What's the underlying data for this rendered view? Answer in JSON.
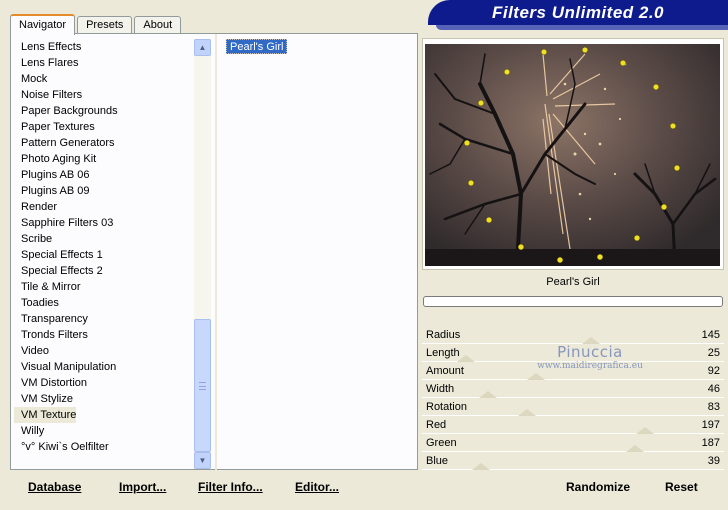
{
  "tabs": [
    {
      "label": "Navigator",
      "active": true
    },
    {
      "label": "Presets",
      "active": false
    },
    {
      "label": "About",
      "active": false
    }
  ],
  "banner": {
    "title": "Filters Unlimited 2.0"
  },
  "categories": {
    "items": [
      "Lens Effects",
      "Lens Flares",
      "Mock",
      "Noise Filters",
      "Paper Backgrounds",
      "Paper Textures",
      "Pattern Generators",
      "Photo Aging Kit",
      "Plugins AB 06",
      "Plugins AB 09",
      "Render",
      "Sapphire Filters 03",
      "Scribe",
      "Special Effects 1",
      "Special Effects 2",
      "Tile & Mirror",
      "Toadies",
      "Transparency",
      "Tronds Filters",
      "Video",
      "Visual Manipulation",
      "VM Distortion",
      "VM Stylize",
      "VM Texture",
      "Willy",
      "°v° Kiwi`s Oelfilter"
    ],
    "selected": "VM Texture"
  },
  "filters": {
    "items": [
      "Pearl's Girl"
    ],
    "selected": "Pearl's Girl"
  },
  "preview": {
    "filter_name": "Pearl's Girl"
  },
  "params": [
    {
      "label": "Radius",
      "value": 145
    },
    {
      "label": "Length",
      "value": 25
    },
    {
      "label": "Amount",
      "value": 92
    },
    {
      "label": "Width",
      "value": 46
    },
    {
      "label": "Rotation",
      "value": 83
    },
    {
      "label": "Red",
      "value": 197
    },
    {
      "label": "Green",
      "value": 187
    },
    {
      "label": "Blue",
      "value": 39
    }
  ],
  "watermark": {
    "name": "Pinuccia",
    "url": "www.maidiregrafica.eu"
  },
  "buttons": {
    "database": "Database",
    "import": "Import...",
    "filter_info": "Filter Info...",
    "editor": "Editor...",
    "randomize": "Randomize",
    "reset": "Reset"
  },
  "colors": {
    "window_bg": "#ece9d8",
    "banner_bg": "#0d1b8c",
    "selection": "#316ac5",
    "tab_accent": "#e68b2c"
  }
}
